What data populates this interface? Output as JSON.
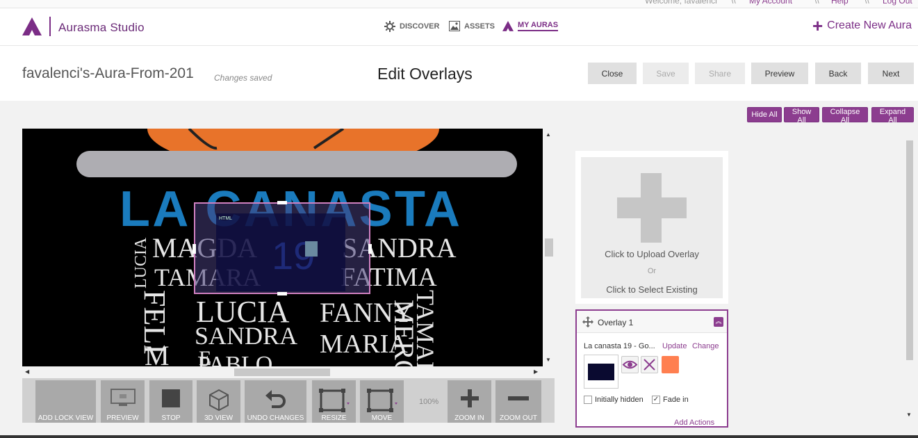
{
  "topbar": {
    "welcome": "Welcome, favalenci",
    "links": [
      "My Account",
      "Help",
      "Log Out"
    ],
    "separators": [
      "\\\\",
      "\\\\",
      "\\\\"
    ]
  },
  "header": {
    "brand": "Aurasma Studio",
    "nav": [
      {
        "label": "DISCOVER",
        "icon": "gear-icon"
      },
      {
        "label": "ASSETS",
        "icon": "image-icon"
      },
      {
        "label": "MY AURAS",
        "icon": "aura-logo-icon",
        "active": true
      }
    ],
    "create_label": "Create New Aura"
  },
  "titlebar": {
    "aura_name": "favalenci's-Aura-From-201",
    "status": "Changes saved",
    "page_title": "Edit Overlays",
    "buttons": [
      {
        "label": "Close",
        "enabled": true
      },
      {
        "label": "Save",
        "enabled": false
      },
      {
        "label": "Share",
        "enabled": false
      },
      {
        "label": "Preview",
        "enabled": true
      },
      {
        "label": "Back",
        "enabled": true
      },
      {
        "label": "Next",
        "enabled": true
      }
    ]
  },
  "panel_actions": [
    "Hide All",
    "Show All",
    "Collapse All",
    "Expand All"
  ],
  "canvas": {
    "trigger_title": "LA CANASTA",
    "names": [
      "MAGDA",
      "SANDRA",
      "TAMARA",
      "FATIMA",
      "LUCIA",
      "LUCIA",
      "FANNY",
      "SANDRA",
      "MARIA",
      "PABLO",
      "FELI",
      "MERC",
      "TAMAR",
      "E",
      "M"
    ],
    "overlay_heading": "HTML",
    "overlay_number": "19"
  },
  "toolbar": {
    "tools": [
      {
        "label": "ADD LOCK VIEW"
      },
      {
        "label": "PREVIEW",
        "icon": "monitor-icon"
      },
      {
        "label": "STOP",
        "icon": "stop-icon"
      },
      {
        "label": "3D VIEW",
        "icon": "cube-icon"
      },
      {
        "label": "UNDO CHANGES",
        "icon": "undo-icon"
      },
      {
        "label": "RESIZE",
        "icon": "resize-icon"
      },
      {
        "label": "MOVE",
        "icon": "move-icon"
      },
      {
        "label": "ZOOM IN",
        "icon": "zoom-in-icon"
      },
      {
        "label": "ZOOM OUT",
        "icon": "zoom-out-icon"
      }
    ],
    "zoom_level": "100%"
  },
  "upload": {
    "upload_label": "Click to Upload Overlay",
    "or_label": "Or",
    "select_label": "Click to Select Existing"
  },
  "overlay_card": {
    "title": "Overlay 1",
    "file_name": "La canasta 19 - Go...",
    "update_label": "Update",
    "change_label": "Change",
    "initially_hidden_label": "Initially hidden",
    "initially_hidden_checked": false,
    "fade_in_label": "Fade in",
    "fade_in_checked": true,
    "add_actions_label": "Add Actions",
    "color": "#ff7f50"
  },
  "colors": {
    "accent": "#8c3d8f",
    "button_gray": "#e0e0e0",
    "tool_gray": "#a9a9a9"
  }
}
